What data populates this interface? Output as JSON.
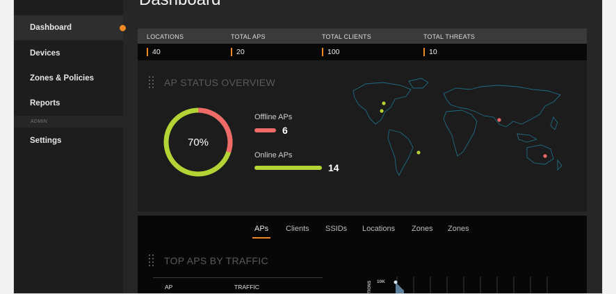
{
  "colors": {
    "accent": "#f08a24",
    "online": "#b4d334",
    "offline": "#f06a6a"
  },
  "page": {
    "title": "Dashboard"
  },
  "sidebar": {
    "items": [
      {
        "label": "Dashboard",
        "active": true
      },
      {
        "label": "Devices"
      },
      {
        "label": "Zones & Policies"
      },
      {
        "label": "Reports"
      }
    ],
    "section_label": "ADMIN",
    "admin_items": [
      {
        "label": "Settings"
      }
    ]
  },
  "stats": [
    {
      "label": "LOCATIONS",
      "value": "40"
    },
    {
      "label": "TOTAL APS",
      "value": "20"
    },
    {
      "label": "TOTAL CLIENTS",
      "value": "100"
    },
    {
      "label": "TOTAL THREATS",
      "value": "10"
    }
  ],
  "ap_status": {
    "title": "AP STATUS OVERVIEW",
    "percent_label": "70%",
    "online_fraction": 0.7,
    "offline": {
      "label": "Offline APs",
      "value": "6"
    },
    "online": {
      "label": "Online APs",
      "value": "14"
    }
  },
  "tabs": [
    {
      "label": "APs",
      "active": true
    },
    {
      "label": "Clients"
    },
    {
      "label": "SSIDs"
    },
    {
      "label": "Locations"
    },
    {
      "label": "Zones"
    },
    {
      "label": "Zones"
    }
  ],
  "top_aps": {
    "title": "TOP APS BY TRAFFIC",
    "columns": [
      "AP",
      "TRAFFIC"
    ],
    "chart_tick": "10K",
    "chart_axis_label": "TIONS"
  }
}
